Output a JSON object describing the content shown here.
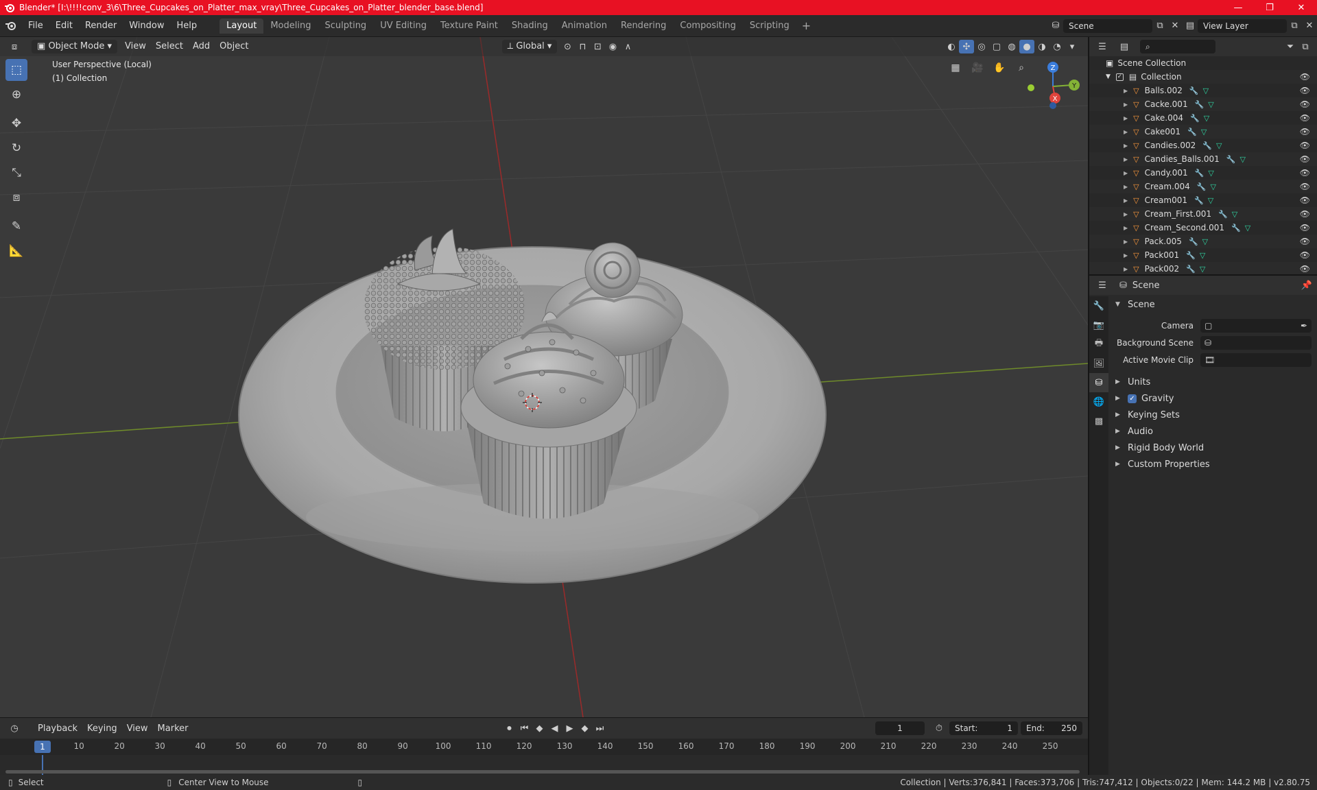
{
  "window": {
    "title": "Blender* [I:\\!!!!conv_3\\6\\Three_Cupcakes_on_Platter_max_vray\\Three_Cupcakes_on_Platter_blender_base.blend]",
    "minimize": "—",
    "maximize": "❐",
    "close": "✕"
  },
  "menu": {
    "items": [
      "File",
      "Edit",
      "Render",
      "Window",
      "Help"
    ],
    "workspaces": [
      "Layout",
      "Modeling",
      "Sculpting",
      "UV Editing",
      "Texture Paint",
      "Shading",
      "Animation",
      "Rendering",
      "Compositing",
      "Scripting"
    ],
    "active_workspace": "Layout",
    "scene": "Scene",
    "view_layer": "View Layer"
  },
  "viewport": {
    "mode": "Object Mode",
    "menus": [
      "View",
      "Select",
      "Add",
      "Object"
    ],
    "transform_orientation": "Global",
    "info_line1": "User Perspective (Local)",
    "info_line2": "(1) Collection",
    "gizmo_labels": {
      "z": "Z",
      "y": "Y",
      "x": "X"
    }
  },
  "outliner": {
    "root": "Scene Collection",
    "collection": "Collection",
    "objects": [
      "Balls.002",
      "Cacke.001",
      "Cake.004",
      "Cake001",
      "Candies.002",
      "Candies_Balls.001",
      "Candy.001",
      "Cream.004",
      "Cream001",
      "Cream_First.001",
      "Cream_Second.001",
      "Pack.005",
      "Pack001",
      "Pack002"
    ]
  },
  "properties": {
    "header": "Scene",
    "section": "Scene",
    "camera_label": "Camera",
    "background_scene_label": "Background Scene",
    "active_movie_clip_label": "Active Movie Clip",
    "panels": [
      "Units",
      "Gravity",
      "Keying Sets",
      "Audio",
      "Rigid Body World",
      "Custom Properties"
    ],
    "gravity_checked": true
  },
  "timeline": {
    "menus": [
      "Playback",
      "Keying",
      "View",
      "Marker"
    ],
    "current_frame": "1",
    "start_label": "Start:",
    "start_value": "1",
    "end_label": "End:",
    "end_value": "250",
    "ruler": [
      "1",
      "10",
      "20",
      "30",
      "40",
      "50",
      "60",
      "70",
      "80",
      "90",
      "100",
      "110",
      "120",
      "130",
      "140",
      "150",
      "160",
      "170",
      "180",
      "190",
      "200",
      "210",
      "220",
      "230",
      "240",
      "250"
    ]
  },
  "status": {
    "select": "Select",
    "center_view": "Center View to Mouse",
    "stats": "Collection | Verts:376,841 | Faces:373,706 | Tris:747,412 | Objects:0/22 | Mem: 144.2 MB | v2.80.75"
  },
  "colors": {
    "title_bar": "#e81123",
    "accent": "#4772b3",
    "object_icon": "#ff9a3c",
    "modifier_icon": "#5fa8ff",
    "mesh_icon": "#2fd6a3"
  }
}
